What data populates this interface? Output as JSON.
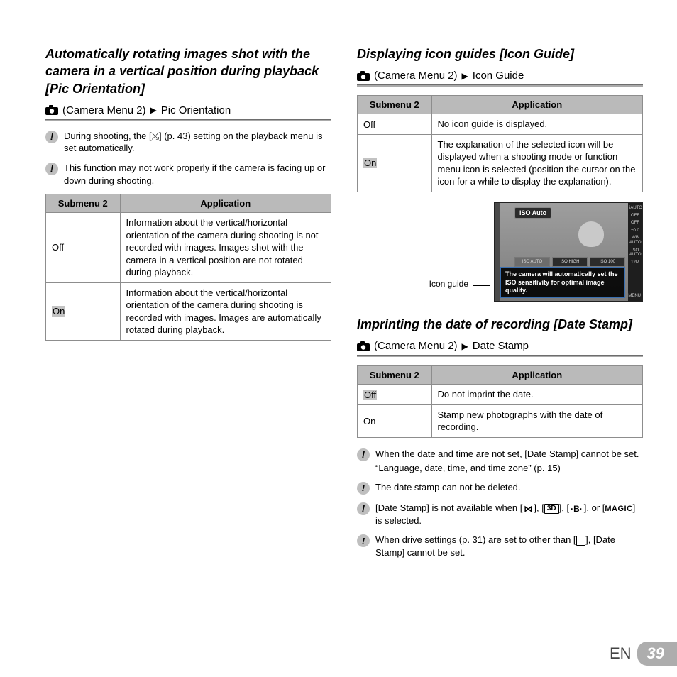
{
  "left": {
    "title": "Automatically rotating images shot with the camera in a vertical position during playback [Pic Orientation]",
    "path_label": "(Camera Menu 2)",
    "path_item": "Pic Orientation",
    "notes": [
      "During shooting, the [⤯] (p. 43) setting on the playback menu is set automatically.",
      "This function may not work properly if the camera is facing up or down during shooting."
    ],
    "table": {
      "head": [
        "Submenu 2",
        "Application"
      ],
      "rows": [
        {
          "setting": "Off",
          "app": "Information about the vertical/horizontal orientation of the camera during shooting is not recorded with images. Images shot with the camera in a vertical position are not rotated during playback."
        },
        {
          "setting": "On",
          "hl": true,
          "app": "Information about the vertical/horizontal orientation of the camera during shooting is recorded with images. Images are automatically rotated during playback."
        }
      ]
    }
  },
  "right_iconguide": {
    "title": "Displaying icon guides [Icon Guide]",
    "path_label": "(Camera Menu 2)",
    "path_item": "Icon Guide",
    "table": {
      "head": [
        "Submenu 2",
        "Application"
      ],
      "rows": [
        {
          "setting": "Off",
          "app": "No icon guide is displayed."
        },
        {
          "setting": "On",
          "hl": true,
          "app": "The explanation of the selected icon will be displayed when a shooting mode or function menu icon is selected (position the cursor on the icon for a while to display the explanation)."
        }
      ]
    },
    "figure": {
      "caption": "Icon guide",
      "badge": "ISO Auto",
      "tip": "The camera will automatically set the ISO sensitivity for optimal image quality.",
      "side_labels": [
        "iAUTO",
        "OFF",
        "OFF",
        "±0.0",
        "WB AUTO",
        "ISO AUTO",
        "",
        "12M",
        "",
        "MENU"
      ],
      "bottom_labels": [
        "ISO AUTO",
        "ISO HIGH",
        "ISO 100"
      ]
    }
  },
  "right_datestamp": {
    "title": "Imprinting the date of recording [Date Stamp]",
    "path_label": "(Camera Menu 2)",
    "path_item": "Date Stamp",
    "table": {
      "head": [
        "Submenu 2",
        "Application"
      ],
      "rows": [
        {
          "setting": "Off",
          "hl": true,
          "app": "Do not imprint the date."
        },
        {
          "setting": "On",
          "app": "Stamp new photographs with the date of recording."
        }
      ]
    },
    "notes": [
      {
        "line1": "When the date and time are not set, [Date Stamp] cannot be set.",
        "line2": "“Language, date, time, and time zone” (p. 15)"
      },
      {
        "line1": "The date stamp can not be deleted."
      },
      {
        "line1_pre": "[Date Stamp] is not available when [",
        "line1_post": "] is selected.",
        "icons": [
          "panorama",
          "3D",
          "beauty",
          "MAGIC"
        ]
      },
      {
        "line1_pre": "When drive settings (p. 31) are set to other than [",
        "line1_post": "], [Date Stamp] cannot be set.",
        "icons": [
          "single"
        ]
      }
    ]
  },
  "footer": {
    "lang": "EN",
    "page": "39"
  }
}
